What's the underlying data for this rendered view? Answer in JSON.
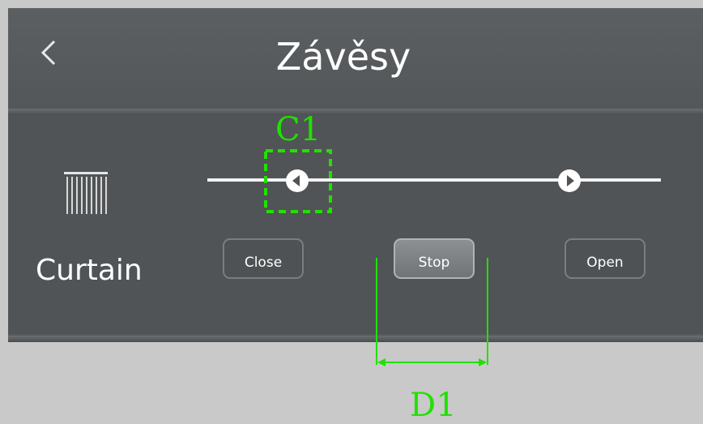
{
  "header": {
    "title": "Závěsy",
    "back_icon": "chevron-left-icon"
  },
  "device": {
    "icon": "curtain-icon",
    "label": "Curtain"
  },
  "slider": {
    "left_knob_icon": "chevron-left-icon",
    "right_knob_icon": "chevron-right-icon"
  },
  "buttons": {
    "close_label": "Close",
    "stop_label": "Stop",
    "open_label": "Open"
  },
  "annotations": {
    "c1_label": "C1",
    "d1_label": "D1",
    "color": "#22e000"
  },
  "colors": {
    "background": "#c9c9c9",
    "screen": "#575b5d",
    "panel": "#505456",
    "text": "#ffffff"
  }
}
